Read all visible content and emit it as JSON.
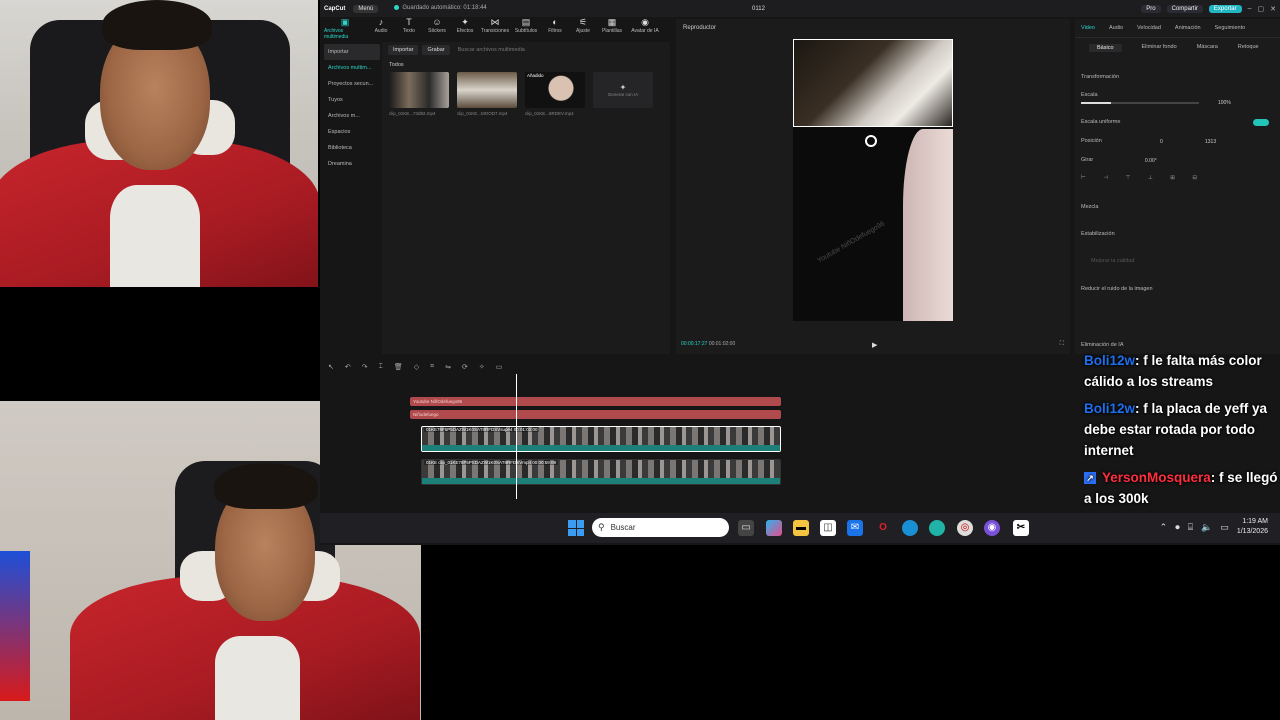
{
  "capcut": {
    "logo": "CapCut",
    "menu": "Menú",
    "autosave": "Guardado automático: 01:18:44",
    "title": "0112",
    "pro": "Pro",
    "share": "Compartir",
    "export": "Exportar",
    "toolbar": [
      {
        "label": "Archivos multimedia",
        "icon": "media-icon"
      },
      {
        "label": "Audio",
        "icon": "audio-icon"
      },
      {
        "label": "Texto",
        "icon": "text-icon"
      },
      {
        "label": "Stickers",
        "icon": "sticker-icon"
      },
      {
        "label": "Efectos",
        "icon": "effects-icon"
      },
      {
        "label": "Transiciones",
        "icon": "transition-icon"
      },
      {
        "label": "Subtítulos",
        "icon": "subtitles-icon"
      },
      {
        "label": "Filtros",
        "icon": "filter-icon"
      },
      {
        "label": "Ajuste",
        "icon": "adjust-icon"
      },
      {
        "label": "Plantillas",
        "icon": "templates-icon"
      },
      {
        "label": "Avatar de IA",
        "icon": "avatar-icon"
      }
    ],
    "nav": [
      "Importar",
      "Archivos multim...",
      "Proyectos secun...",
      "Tuyos",
      "Archivos m...",
      "Espacios",
      "Biblioteca",
      "Dreamina"
    ],
    "media": {
      "import_btn": "Importar",
      "record_btn": "Grabar",
      "search_placeholder": "Buscar archivos multimedia",
      "all": "Todos",
      "clips": [
        {
          "name": "clip_01KE...73d92.mp4",
          "badge": ""
        },
        {
          "name": "clip_01KE...MOOD7.mp4",
          "badge": ""
        },
        {
          "name": "clip_01KE...8RDEV.mp4",
          "badge": "Añadido"
        }
      ],
      "ai_gen": "Generar con IA"
    },
    "player": {
      "title": "Reproductor",
      "current": "00:00:17:27",
      "total": "00:01:02:00",
      "watermark": "Youtube NiñOdefuego96"
    },
    "inspector": {
      "tabs": [
        "Video",
        "Audio",
        "Velocidad",
        "Animación",
        "Seguimiento"
      ],
      "subtabs": [
        "Básico",
        "Eliminar fondo",
        "Máscara",
        "Retoque"
      ],
      "transform": "Transformación",
      "scale": "Escala",
      "scale_val": "100%",
      "uniform": "Escala uniforme",
      "position": "Posición",
      "pos_x": "0",
      "pos_y": "1313",
      "rotate": "Girar",
      "rotate_val": "0.00°",
      "blend": "Mezcla",
      "stabilize": "Estabilización",
      "improve_quality": "Mejorar la calidad",
      "noise": "Reducir el ruido de la imagen",
      "color_correction": "Eliminación de IA"
    },
    "timeline": {
      "text_track1": "Youtube NiñOdefuego96",
      "text_track2": "Niñodefuego",
      "video1_label": "01KE78F5P5DAZW1K0SAT8RFDSVsupe4  00:01:02:00",
      "video2_label": "01KE  clip_01KE78F5PSDAZW1K0SAT8RFDSVmp4  00:00:59:09"
    }
  },
  "taskbar": {
    "search_placeholder": "Buscar",
    "time": "1:19 AM",
    "date": "1/13/2026"
  },
  "chat": [
    {
      "user": "Boli12w",
      "text": ": f le falta más color cálido a los streams"
    },
    {
      "user": "Boli12w",
      "text": ": f la placa de yeff ya debe estar rotada por todo internet"
    },
    {
      "user": "YersonMosquera",
      "text": ": f se llegó a los 300k"
    }
  ]
}
